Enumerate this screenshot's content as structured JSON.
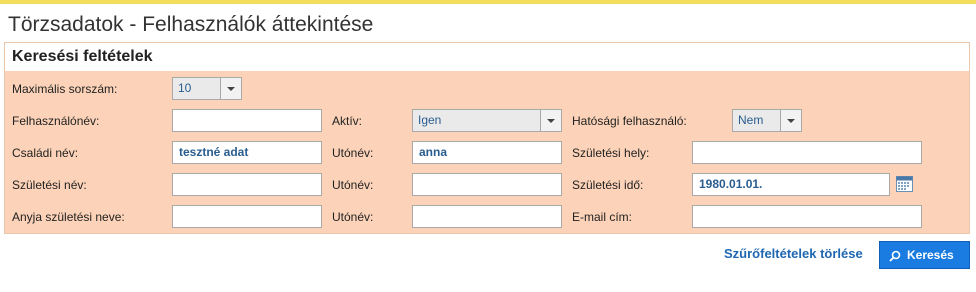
{
  "page": {
    "title": "Törzsadatok - Felhasználók áttekintése"
  },
  "panel": {
    "title": "Keresési feltételek"
  },
  "fields": {
    "max_rows": {
      "label": "Maximális sorszám:",
      "value": "10"
    },
    "username": {
      "label": "Felhasználónév:",
      "value": ""
    },
    "active": {
      "label": "Aktív:",
      "value": "Igen"
    },
    "authority_user": {
      "label": "Hatósági felhasználó:",
      "value": "Nem"
    },
    "family_name": {
      "label": "Családi név:",
      "value": "tesztné adat"
    },
    "given_name": {
      "label": "Utónév:",
      "value": "anna"
    },
    "birth_place": {
      "label": "Születési hely:",
      "value": ""
    },
    "birth_family_name": {
      "label": "Születési név:",
      "value": ""
    },
    "birth_given_name": {
      "label": "Utónév:",
      "value": ""
    },
    "birth_date": {
      "label": "Születési idő:",
      "value": "1980.01.01."
    },
    "mother_family_name": {
      "label": "Anyja születési neve:",
      "value": ""
    },
    "mother_given_name": {
      "label": "Utónév:",
      "value": ""
    },
    "email": {
      "label": "E-mail cím:",
      "value": ""
    }
  },
  "actions": {
    "clear_label": "Szűrőfeltételek törlése",
    "search_label": "Keresés"
  },
  "icons": {
    "calendar": "calendar-icon",
    "search": "search-icon",
    "dropdown": "chevron-down-icon"
  },
  "colors": {
    "panel_bg": "#fcd3b8",
    "accent": "#1a7be0",
    "link": "#1f67b0",
    "value_text": "#2a5d8f",
    "top_bar": "#f3de5c"
  }
}
